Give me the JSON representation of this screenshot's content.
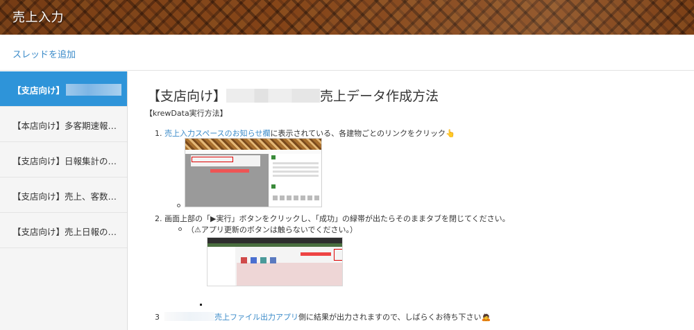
{
  "app": {
    "title": "売上入力"
  },
  "topbar": {
    "add_thread": "スレッドを追加"
  },
  "sidebar": {
    "items": [
      {
        "label": "【支店向け】",
        "active": true
      },
      {
        "label": "【本店向け】多客期速報…",
        "active": false
      },
      {
        "label": "【支店向け】日報集計の…",
        "active": false
      },
      {
        "label": "【支店向け】売上、客数…",
        "active": false
      },
      {
        "label": "【支店向け】売上日報の…",
        "active": false
      }
    ]
  },
  "main": {
    "title_prefix": "【支店向け】",
    "title_suffix": "売上データ作成方法",
    "subtitle": "【krewData実行方法】",
    "step1": {
      "num": "1.",
      "link": "売上入力スペースのお知らせ欄",
      "text": "に表示されている、各建物ごとのリンクをクリック",
      "emoji": "👆"
    },
    "step2": {
      "num": "2.",
      "text": "画面上部の「▶実行」ボタンをクリックし、「成功」の緑帯が出たらそのままタブを閉じてください。",
      "note": "（⚠アプリ更新のボタンは触らないでください。）"
    },
    "step3": {
      "num": "3",
      "link": "売上ファイル出力アプリ",
      "text": "側に結果が出力されますので、しばらくお待ち下さい",
      "emoji": "🙇"
    }
  },
  "colors": {
    "accent": "#2e94d9",
    "link": "#3b8bc9"
  }
}
